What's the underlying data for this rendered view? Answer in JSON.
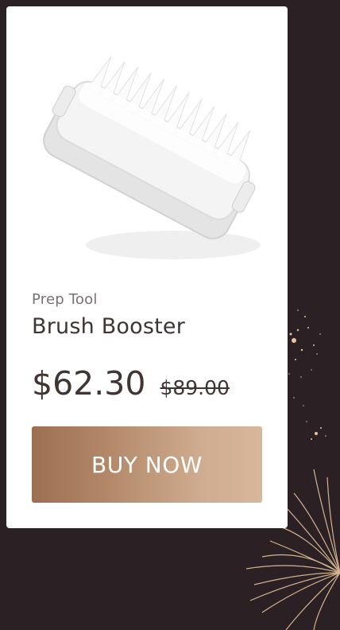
{
  "product": {
    "category": "Prep Tool",
    "name": "Brush Booster",
    "price": "$62.30",
    "old_price": "$89.00",
    "image_icon": "brush-product-icon"
  },
  "actions": {
    "buy_label": "BUY NOW"
  },
  "colors": {
    "page_background": "#2b2023",
    "card_background": "#ffffff",
    "text_primary": "#3f3533",
    "text_secondary": "#7a7272",
    "button_gradient_start": "#9c6f50",
    "button_gradient_end": "#d8b699",
    "firework": "#e7c49d"
  }
}
